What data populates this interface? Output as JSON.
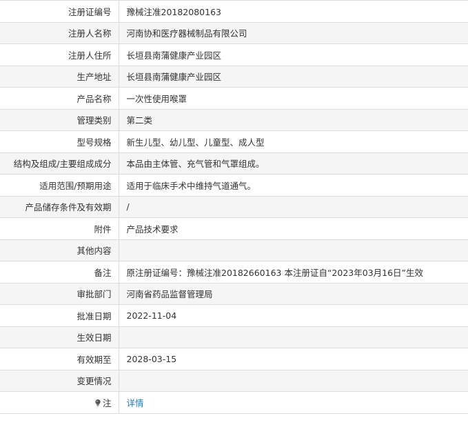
{
  "rows": [
    {
      "label": "注册证编号",
      "value": "豫械注准20182080163"
    },
    {
      "label": "注册人名称",
      "value": "河南协和医疗器械制品有限公司"
    },
    {
      "label": "注册人住所",
      "value": "长垣县南蒲健康产业园区"
    },
    {
      "label": "生产地址",
      "value": "长垣县南蒲健康产业园区"
    },
    {
      "label": "产品名称",
      "value": "一次性使用喉罩"
    },
    {
      "label": "管理类别",
      "value": "第二类"
    },
    {
      "label": "型号规格",
      "value": "新生儿型、幼儿型、儿童型、成人型"
    },
    {
      "label": "结构及组成/主要组成成分",
      "value": "本品由主体管、充气管和气罩组成。"
    },
    {
      "label": "适用范围/预期用途",
      "value": "适用于临床手术中维持气道通气。"
    },
    {
      "label": "产品储存条件及有效期",
      "value": "/"
    },
    {
      "label": "附件",
      "value": "产品技术要求"
    },
    {
      "label": "其他内容",
      "value": ""
    },
    {
      "label": "备注",
      "value": "原注册证编号：豫械注准20182660163 本注册证自“2023年03月16日”生效"
    },
    {
      "label": "审批部门",
      "value": "河南省药品监督管理局"
    },
    {
      "label": "批准日期",
      "value": "2022-11-04"
    },
    {
      "label": "生效日期",
      "value": ""
    },
    {
      "label": "有效期至",
      "value": "2028-03-15"
    },
    {
      "label": "变更情况",
      "value": ""
    }
  ],
  "note": {
    "label": "注",
    "icon": "lightbulb-icon",
    "link_text": "详情",
    "link_color": "#1a7ec0"
  }
}
